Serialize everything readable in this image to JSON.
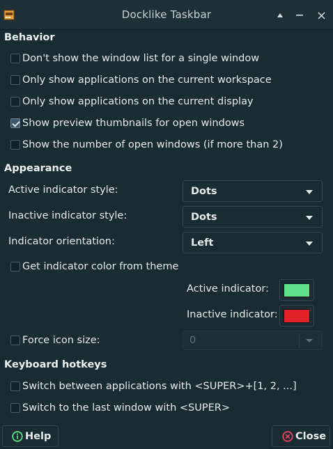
{
  "window": {
    "title": "Docklike Taskbar",
    "icons": {
      "app": "taskbar-app-icon",
      "shade": "shade-up-icon",
      "minimize": "minimize-icon",
      "close": "close-x-icon"
    }
  },
  "behavior": {
    "heading": "Behavior",
    "options": [
      {
        "label": "Don't show the window list for a single window",
        "checked": false
      },
      {
        "label": "Only show applications on the current workspace",
        "checked": false
      },
      {
        "label": "Only show applications on the current display",
        "checked": false
      },
      {
        "label": "Show preview thumbnails for open windows",
        "checked": true
      },
      {
        "label": "Show the number of open windows (if more than 2)",
        "checked": false
      }
    ]
  },
  "appearance": {
    "heading": "Appearance",
    "active_style": {
      "label": "Active indicator style:",
      "value": "Dots"
    },
    "inactive_style": {
      "label": "Inactive indicator style:",
      "value": "Dots"
    },
    "orientation": {
      "label": "Indicator orientation:",
      "value": "Left"
    },
    "theme_color": {
      "label": "Get indicator color from theme",
      "checked": false
    },
    "active_color": {
      "label": "Active indicator:",
      "color": "#5de08a"
    },
    "inactive_color": {
      "label": "Inactive indicator:",
      "color": "#e02128"
    },
    "force_icon_size": {
      "label": "Force icon size:",
      "checked": false,
      "value": "0"
    }
  },
  "hotkeys": {
    "heading": "Keyboard hotkeys",
    "options": [
      {
        "label": "Switch between applications with <SUPER>+[1, 2, ...]",
        "checked": false
      },
      {
        "label": "Switch to the last window with <SUPER>",
        "checked": false
      }
    ]
  },
  "buttons": {
    "help": {
      "label": "Help",
      "icon": "help-circle-icon",
      "color": "#5de08a"
    },
    "close": {
      "label": "Close",
      "icon": "close-circle-icon",
      "color": "#e0435c"
    }
  }
}
